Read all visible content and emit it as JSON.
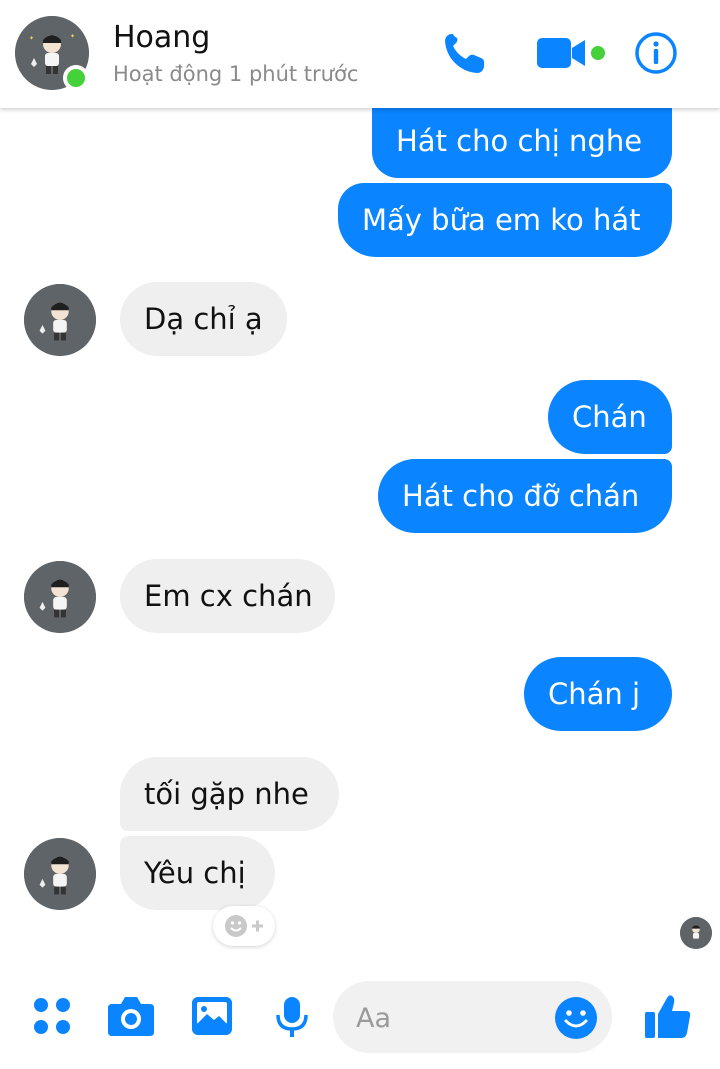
{
  "header": {
    "name": "Hoang",
    "status": "Hoạt động 1 phút trước",
    "icons": [
      "phone-icon",
      "video-camera-icon",
      "info-icon"
    ]
  },
  "messages": [
    {
      "dir": "out",
      "text": "Hát cho chị nghe"
    },
    {
      "dir": "out",
      "text": "Mấy bữa em ko hát"
    },
    {
      "dir": "in",
      "text": "Dạ chỉ ạ"
    },
    {
      "dir": "out",
      "text": "Chán"
    },
    {
      "dir": "out",
      "text": "Hát cho đỡ chán"
    },
    {
      "dir": "in",
      "text": "Em cx chán"
    },
    {
      "dir": "out",
      "text": "Chán j"
    },
    {
      "dir": "in",
      "text": "tối gặp nhe"
    },
    {
      "dir": "in",
      "text": "Yêu chị"
    }
  ],
  "composer": {
    "placeholder": "Aa",
    "icons": [
      "menu-dots-icon",
      "camera-icon",
      "gallery-icon",
      "microphone-icon",
      "emoji-icon",
      "like-icon"
    ]
  },
  "colors": {
    "accent": "#0a84ff",
    "online": "#44d13a",
    "incoming_bubble": "#efefef"
  }
}
